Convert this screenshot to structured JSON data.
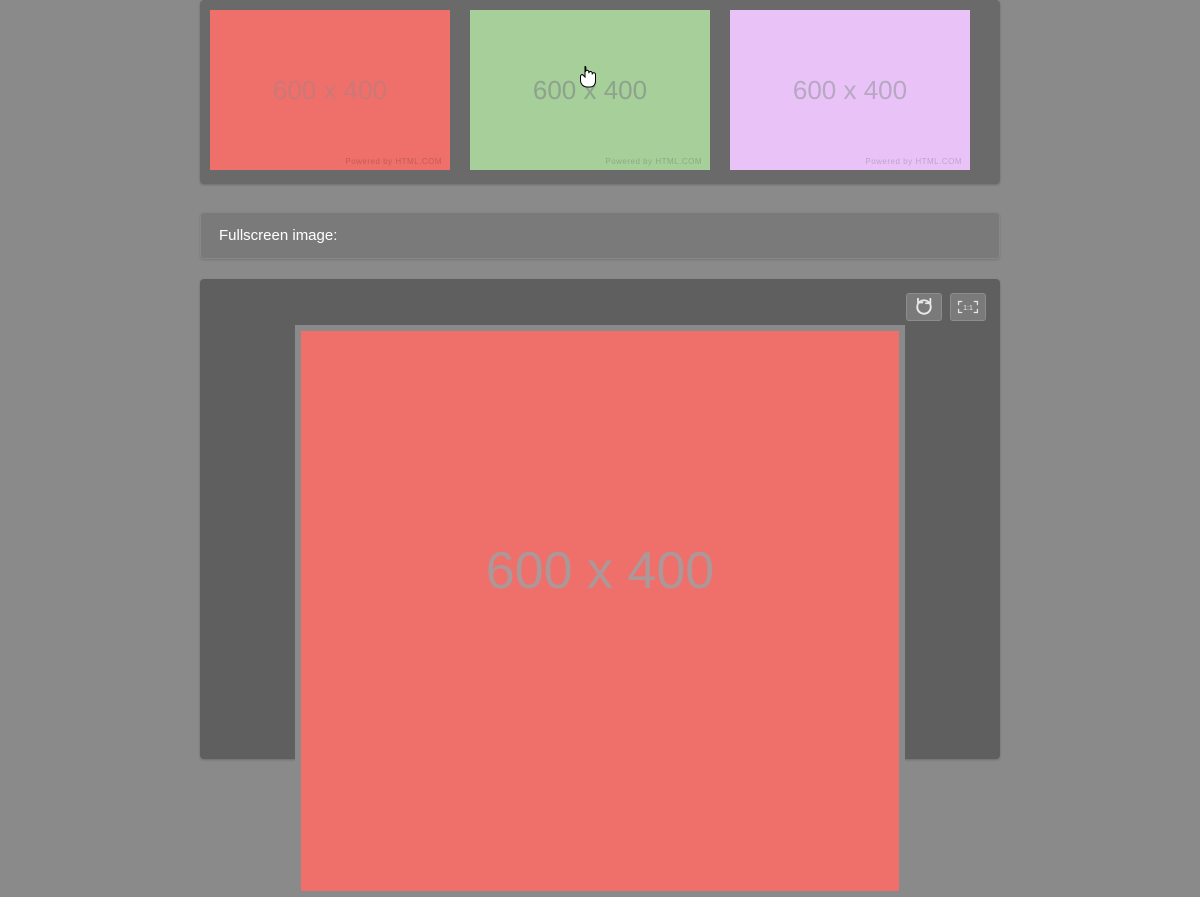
{
  "gallery": {
    "thumbnails": [
      {
        "label": "600 x 400",
        "color": "#ef6f6a",
        "watermark": "Powered by HTML.COM"
      },
      {
        "label": "600 x 400",
        "color": "#a7cf9a",
        "watermark": "Powered by HTML.COM"
      },
      {
        "label": "600 x 400",
        "color": "#e9c3f8",
        "watermark": "Powered by HTML.COM"
      }
    ]
  },
  "section": {
    "fullscreen_heading": "Fullscreen image:"
  },
  "viewer": {
    "main_image_label": "600 x 400",
    "main_image_color": "#ef6f6a",
    "toolbar": {
      "rotate": "rotate-icon",
      "actual_size_label": "1:1"
    }
  }
}
